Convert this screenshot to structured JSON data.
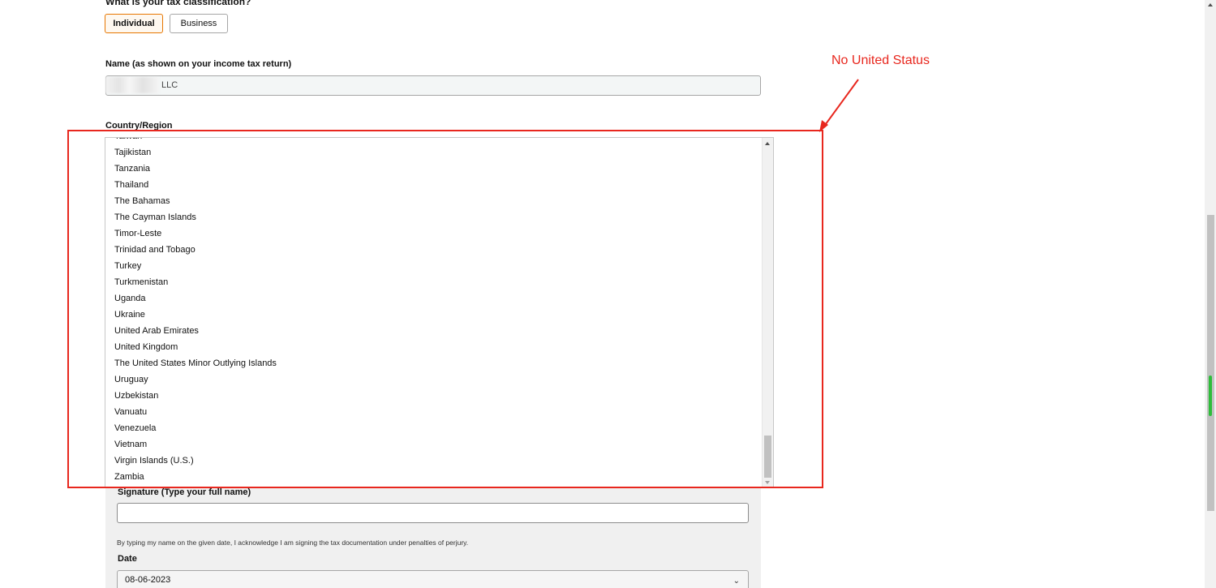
{
  "form": {
    "tax_question": "What is your tax classification?",
    "classification_options": [
      "Individual",
      "Business"
    ],
    "selected_classification": "Individual",
    "name_label": "Name (as shown on your income tax return)",
    "name_value": "LLC",
    "country_label": "Country/Region",
    "country_options_visible": [
      "Taiwan",
      "Tajikistan",
      "Tanzania",
      "Thailand",
      "The Bahamas",
      "The Cayman Islands",
      "Timor-Leste",
      "Trinidad and Tobago",
      "Turkey",
      "Turkmenistan",
      "Uganda",
      "Ukraine",
      "United Arab Emirates",
      "United Kingdom",
      "The United States Minor Outlying Islands",
      "Uruguay",
      "Uzbekistan",
      "Vanuatu",
      "Venezuela",
      "Vietnam",
      "Virgin Islands (U.S.)",
      "Zambia"
    ],
    "signature_label": "Signature (Type your full name)",
    "signature_value": "",
    "acknowledgement": "By typing my name on the given date, I acknowledge I am signing the tax documentation under penalties of perjury.",
    "date_label": "Date",
    "date_value": "08-06-2023"
  },
  "annotation": {
    "text": "No United Status",
    "color": "#e8271e"
  },
  "colors": {
    "selected_border": "#e77600",
    "grey_section": "#f0f0f0",
    "scroll_indicator": "#2ebd3b"
  },
  "scroll": {
    "dropdown_scroll_position_fraction": 1.0,
    "page_scroll_position_fraction": 0.6
  }
}
